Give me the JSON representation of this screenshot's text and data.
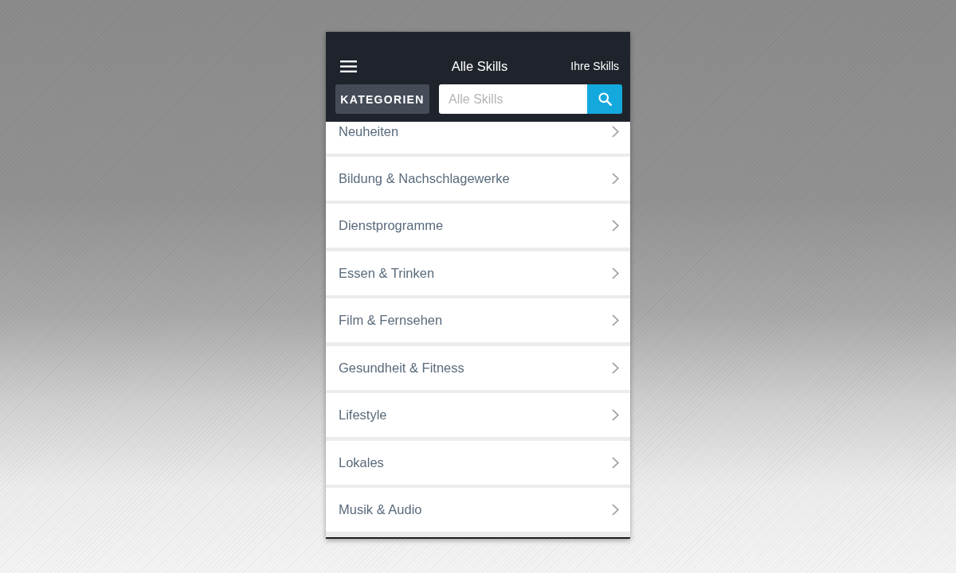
{
  "header": {
    "title": "Alle Skills",
    "link": "Ihre Skills"
  },
  "search_bar": {
    "categories_button": "KATEGORIEN",
    "search": {
      "placeholder": "Alle Skills"
    }
  },
  "categories": [
    {
      "label": "Neuheiten"
    },
    {
      "label": "Bildung & Nachschlagewerke"
    },
    {
      "label": "Dienstprogramme"
    },
    {
      "label": "Essen & Trinken"
    },
    {
      "label": "Film & Fernsehen"
    },
    {
      "label": "Gesundheit & Fitness"
    },
    {
      "label": "Lifestyle"
    },
    {
      "label": "Lokales"
    },
    {
      "label": "Musik & Audio"
    }
  ]
}
